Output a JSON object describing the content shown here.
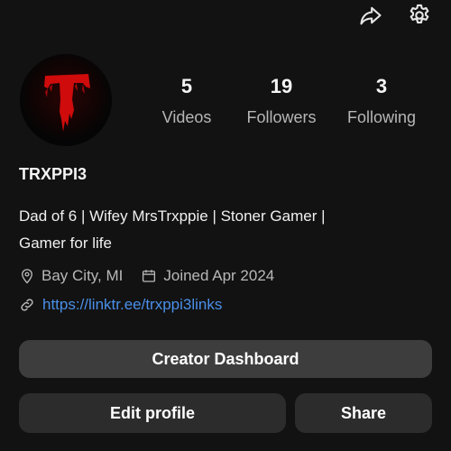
{
  "header": {
    "share_icon": "share-arrow-icon",
    "settings_icon": "gear-icon"
  },
  "profile": {
    "avatar_icon": "red-dripping-t-logo",
    "username": "TRXPPI3",
    "bio_line1": "Dad of 6 | Wifey MrsTrxppie | Stoner Gamer |",
    "bio_line2": "Gamer for life",
    "location": "Bay City, MI",
    "joined": "Joined Apr 2024",
    "link": "https://linktr.ee/trxppi3links"
  },
  "stats": [
    {
      "value": "5",
      "label": "Videos"
    },
    {
      "value": "19",
      "label": "Followers"
    },
    {
      "value": "3",
      "label": "Following"
    }
  ],
  "buttons": {
    "dashboard": "Creator Dashboard",
    "edit": "Edit profile",
    "share": "Share"
  },
  "colors": {
    "background": "#121212",
    "link": "#4a8fe8",
    "logo_red": "#d10d0d"
  }
}
